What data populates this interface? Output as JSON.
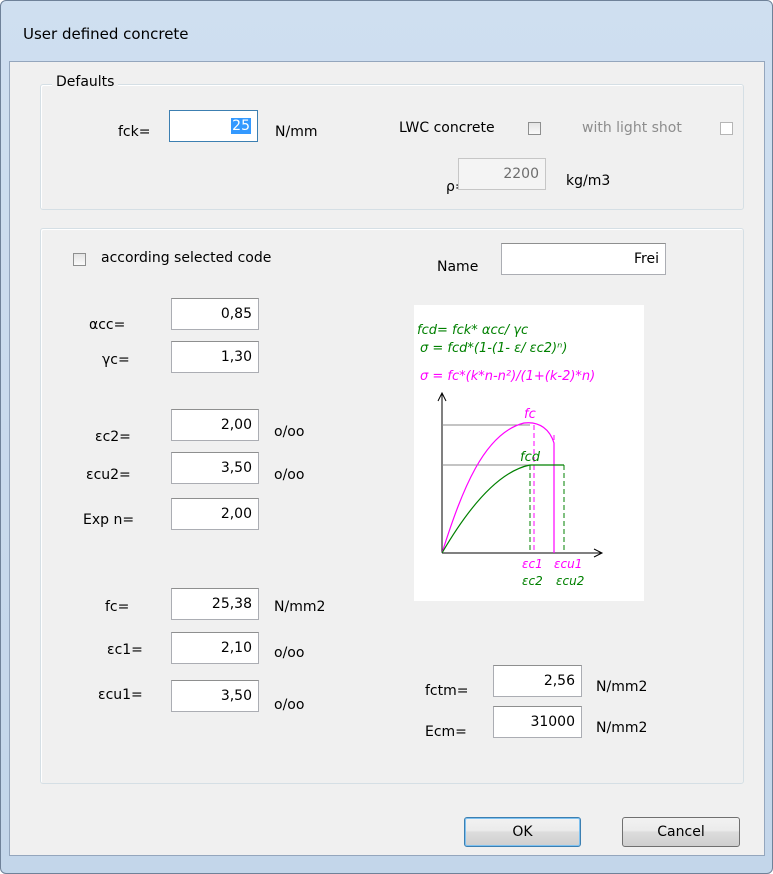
{
  "window": {
    "title": "User defined concrete"
  },
  "defaults": {
    "legend": "Defaults",
    "fck_label": "fck=",
    "fck_value": "25",
    "fck_unit": "N/mm",
    "lwc_label": "LWC concrete",
    "lwc_checked": false,
    "light_shot_label": "with  light shot",
    "light_shot_checked": false,
    "rho_label": "ρ=",
    "rho_value": "2200",
    "rho_unit": "kg/m3"
  },
  "params": {
    "according_label": "according selected code",
    "according_checked": false,
    "name_label": "Name",
    "name_value": "Frei",
    "rows": [
      {
        "label": "αcc=",
        "value": "0,85",
        "unit": ""
      },
      {
        "label": "γc=",
        "value": "1,30",
        "unit": ""
      },
      {
        "label": "εc2=",
        "value": "2,00",
        "unit": "o/oo"
      },
      {
        "label": "εcu2=",
        "value": "3,50",
        "unit": "o/oo"
      },
      {
        "label": "Exp n=",
        "value": "2,00",
        "unit": ""
      },
      {
        "label": "fc=",
        "value": "25,38",
        "unit": "N/mm2"
      },
      {
        "label": "εc1=",
        "value": "2,10",
        "unit": "o/oo"
      },
      {
        "label": "εcu1=",
        "value": "3,50",
        "unit": "o/oo"
      }
    ],
    "fctm_label": "fctm=",
    "fctm_value": "2,56",
    "fctm_unit": "N/mm2",
    "ecm_label": "Ecm=",
    "ecm_value": "31000",
    "ecm_unit": "N/mm2"
  },
  "diagram": {
    "formula1": "fcd= fck* αcc/ γc",
    "formula2": "σ = fcd*(1-(1- ε/ εc2)ⁿ)",
    "formula3": "σ = fc*(k*n-n²)/(1+(k-2)*n)",
    "label_fc": "fc",
    "label_fcd": "fcd",
    "label_ec1": "εc1",
    "label_ecu1": "εcu1",
    "label_ec2": "εc2",
    "label_ecu2": "εcu2",
    "green_color": "#008000",
    "pink_color": "#ff00ff"
  },
  "buttons": {
    "ok": "OK",
    "cancel": "Cancel"
  }
}
